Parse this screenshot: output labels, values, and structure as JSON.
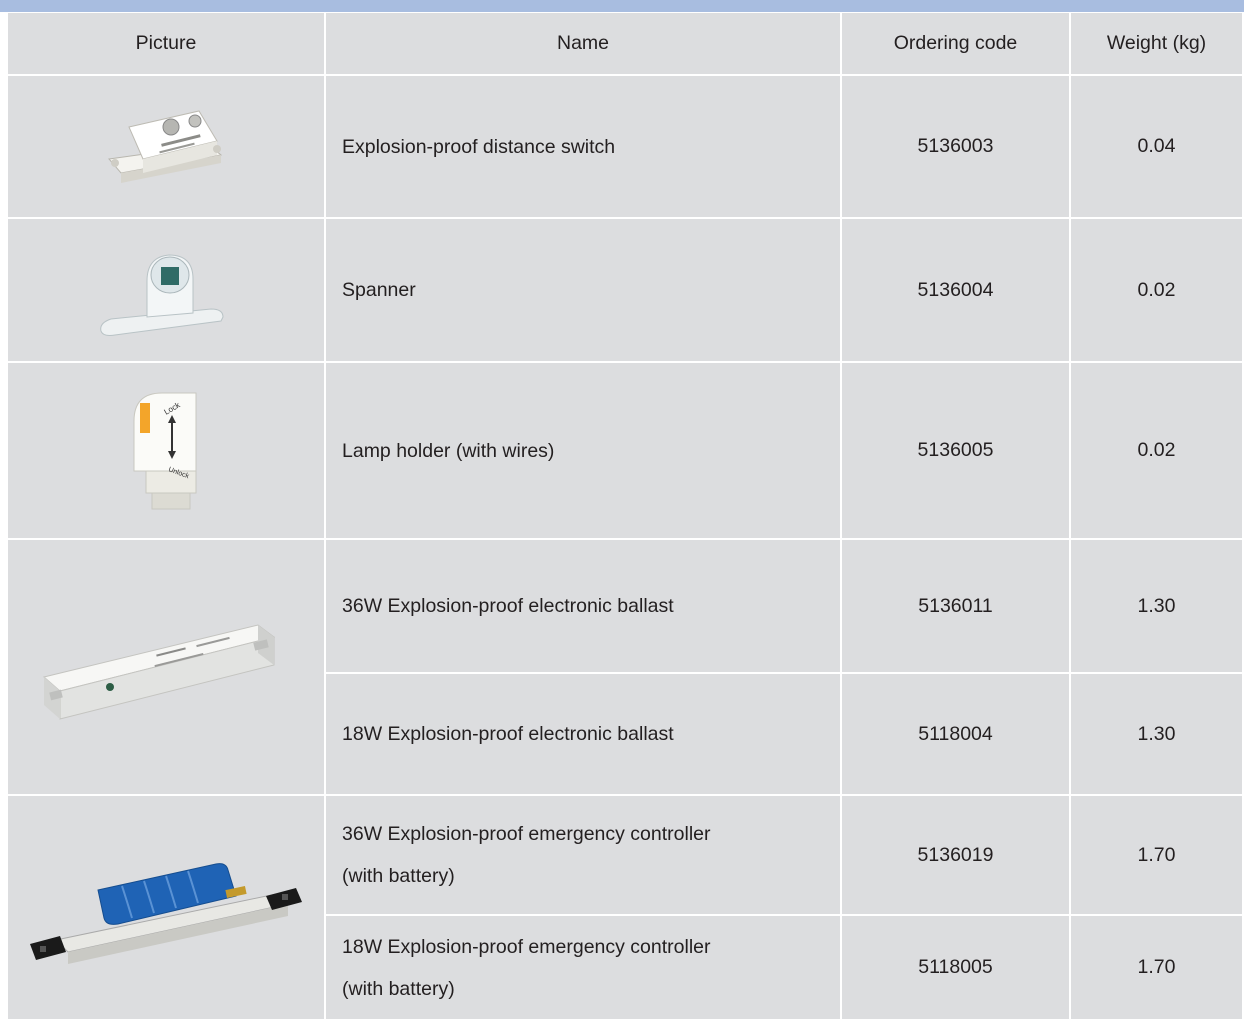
{
  "table": {
    "headers": {
      "picture": "Picture",
      "name": "Name",
      "code": "Ordering code",
      "weight": "Weight (kg)"
    },
    "rows": [
      {
        "name": "Explosion-proof distance switch",
        "code": "5136003",
        "weight": "0.04",
        "picture_icon": "distance-switch-image"
      },
      {
        "name": "Spanner",
        "code": "5136004",
        "weight": "0.02",
        "picture_icon": "spanner-image"
      },
      {
        "name": "Lamp holder (with wires)",
        "code": "5136005",
        "weight": "0.02",
        "picture_icon": "lamp-holder-image",
        "lock_label": "Lock",
        "unlock_label": "Unlock"
      },
      {
        "name": "36W Explosion-proof electronic ballast",
        "code": "5136011",
        "weight": "1.30",
        "picture_icon": "electronic-ballast-image"
      },
      {
        "name": "18W Explosion-proof electronic ballast",
        "code": "5118004",
        "weight": "1.30"
      },
      {
        "name_line1": "36W Explosion-proof emergency controller",
        "name_line2": "(with battery)",
        "code": "5136019",
        "weight": "1.70",
        "picture_icon": "emergency-controller-image"
      },
      {
        "name_line1": "18W Explosion-proof emergency controller",
        "name_line2": "(with battery)",
        "code": "5118005",
        "weight": "1.70"
      }
    ]
  },
  "colors": {
    "header_band": "#a8bde0",
    "cell_background": "#dcdddf",
    "text": "#231f20"
  }
}
